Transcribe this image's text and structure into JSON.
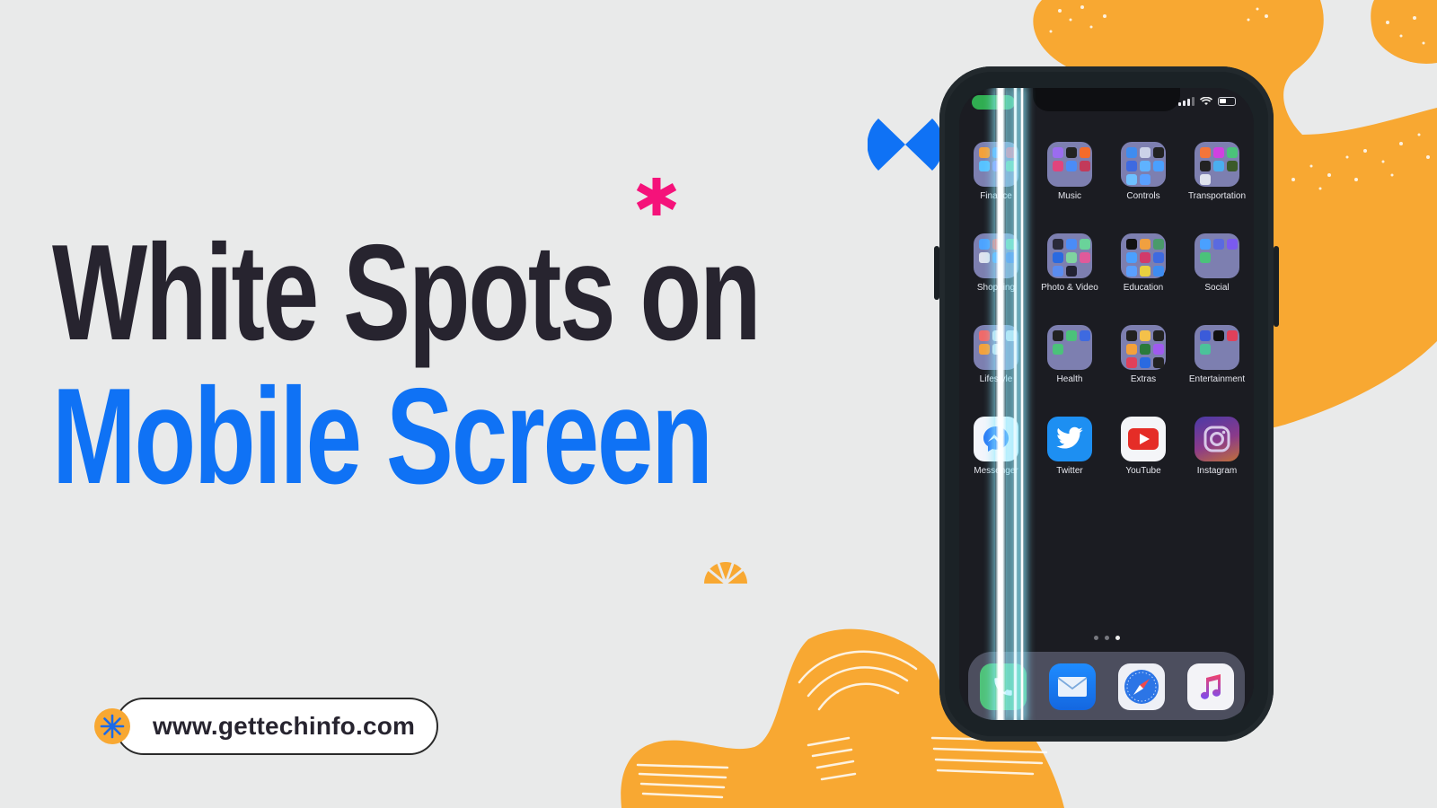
{
  "headline": {
    "line1": "White Spots on",
    "line2": "Mobile Screen"
  },
  "website": {
    "url": "www.gettechinfo.com",
    "badge_icon": "asterisk-star-icon"
  },
  "colors": {
    "background": "#e9eaea",
    "headline_dark": "#27242f",
    "headline_blue": "#0f72f5",
    "accent_orange": "#f8a832",
    "accent_pink": "#f5127a",
    "accent_blue": "#0f72f5"
  },
  "decorations": {
    "pink_asterisk": "asterisk-icon",
    "blue_bowtie": "bowtie-shape",
    "orange_sunburst": "sunburst-icon"
  },
  "phone": {
    "status_bar": {
      "signal_icon": "cellular-signal-icon",
      "wifi_icon": "wifi-icon",
      "battery_icon": "battery-icon"
    },
    "apps": [
      {
        "label": "Finance",
        "type": "folder"
      },
      {
        "label": "Music",
        "type": "folder"
      },
      {
        "label": "Controls",
        "type": "folder"
      },
      {
        "label": "Transportation",
        "type": "folder"
      },
      {
        "label": "Shopping",
        "type": "folder"
      },
      {
        "label": "Photo & Video",
        "type": "folder"
      },
      {
        "label": "Education",
        "type": "folder"
      },
      {
        "label": "Social",
        "type": "folder"
      },
      {
        "label": "Lifestyle",
        "type": "folder"
      },
      {
        "label": "Health",
        "type": "folder"
      },
      {
        "label": "Extras",
        "type": "folder"
      },
      {
        "label": "Entertainment",
        "type": "folder"
      },
      {
        "label": "Messenger",
        "type": "app"
      },
      {
        "label": "Twitter",
        "type": "app"
      },
      {
        "label": "YouTube",
        "type": "app"
      },
      {
        "label": "Instagram",
        "type": "app"
      }
    ],
    "page_dots": {
      "count": 3,
      "active_index": 2
    },
    "dock": [
      {
        "name": "Phone",
        "icon": "phone-icon"
      },
      {
        "name": "Mail",
        "icon": "mail-icon"
      },
      {
        "name": "Safari",
        "icon": "safari-compass-icon"
      },
      {
        "name": "Music",
        "icon": "music-note-icon"
      }
    ]
  }
}
